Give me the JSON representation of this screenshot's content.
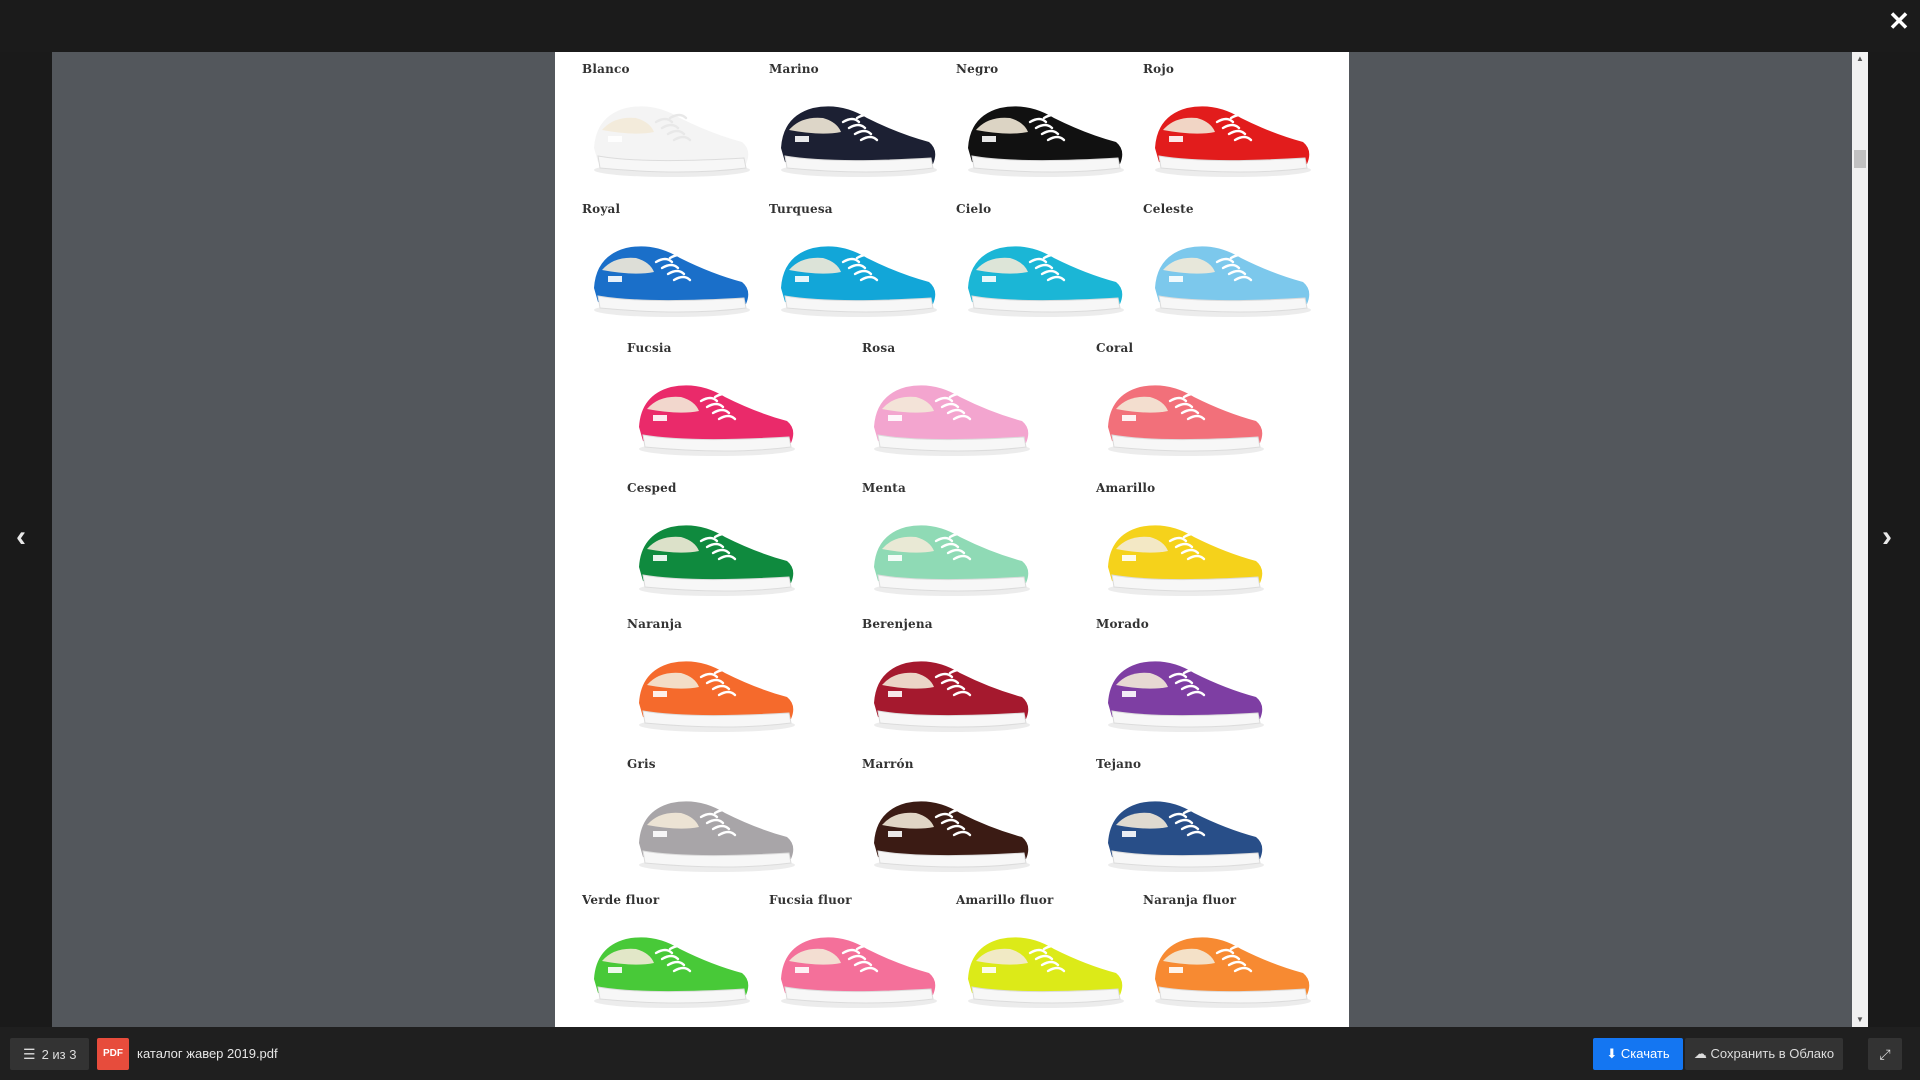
{
  "viewer": {
    "close_icon": "close-icon",
    "prev_icon": "chevron-left-icon",
    "next_icon": "chevron-right-icon"
  },
  "catalog": {
    "rows": [
      {
        "layout": "four",
        "items": [
          {
            "name": "Blanco",
            "color": "#f4f4f4"
          },
          {
            "name": "Marino",
            "color": "#1c2033"
          },
          {
            "name": "Negro",
            "color": "#111111"
          },
          {
            "name": "Rojo",
            "color": "#e21c1c"
          }
        ]
      },
      {
        "layout": "four",
        "items": [
          {
            "name": "Royal",
            "color": "#1a6fc9"
          },
          {
            "name": "Turquesa",
            "color": "#12a6d8"
          },
          {
            "name": "Cielo",
            "color": "#1bb6d6"
          },
          {
            "name": "Celeste",
            "color": "#7cc8ec"
          }
        ]
      },
      {
        "layout": "three",
        "items": [
          {
            "name": "Fucsia",
            "color": "#ea2a6a"
          },
          {
            "name": "Rosa",
            "color": "#f3a5cf"
          },
          {
            "name": "Coral",
            "color": "#f2707a"
          }
        ]
      },
      {
        "layout": "three",
        "items": [
          {
            "name": "Cesped",
            "color": "#0f8a3e"
          },
          {
            "name": "Menta",
            "color": "#8fdab5"
          },
          {
            "name": "Amarillo",
            "color": "#f5d21b"
          }
        ]
      },
      {
        "layout": "three",
        "items": [
          {
            "name": "Naranja",
            "color": "#f56a2c"
          },
          {
            "name": "Berenjena",
            "color": "#a5192e"
          },
          {
            "name": "Morado",
            "color": "#7e3ea3"
          }
        ]
      },
      {
        "layout": "three",
        "items": [
          {
            "name": "Gris",
            "color": "#a8a5a8"
          },
          {
            "name": "Marrón",
            "color": "#3b1b14"
          },
          {
            "name": "Tejano",
            "color": "#284e88"
          }
        ]
      },
      {
        "layout": "four",
        "items": [
          {
            "name": "Verde fluor",
            "color": "#48c938"
          },
          {
            "name": "Fucsia fluor",
            "color": "#f4709a"
          },
          {
            "name": "Amarillo fluor",
            "color": "#dcea18"
          },
          {
            "name": "Naranja fluor",
            "color": "#f78a32"
          }
        ]
      }
    ]
  },
  "footer": {
    "pages_label": "2 из 3",
    "file_type": "PDF",
    "filename": "каталог жавер 2019.pdf",
    "download_label": "Скачать",
    "cloud_label": "Сохранить в Облако"
  }
}
